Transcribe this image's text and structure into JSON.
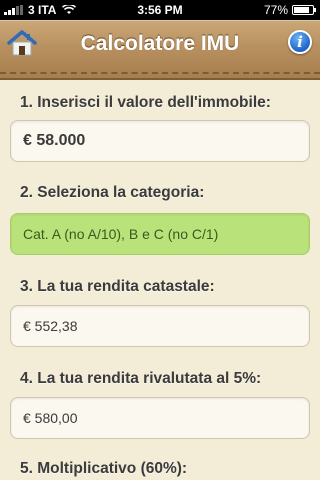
{
  "status": {
    "carrier": "3 ITA",
    "time": "3:56 PM",
    "battery": "77%"
  },
  "nav": {
    "title": "Calcolatore IMU",
    "home_icon": "home-icon",
    "info_icon": "info-icon",
    "info_glyph": "i"
  },
  "form": {
    "step1_label": "1. Inserisci il valore dell'immobile:",
    "step1_value": "€ 58.000",
    "step2_label": "2. Seleziona la categoria:",
    "step2_value": "Cat. A (no A/10), B e C (no C/1)",
    "step3_label": "3. La tua rendita catastale:",
    "step3_value": "€ 552,38",
    "step4_label": "4. La tua rendita rivalutata  al 5%:",
    "step4_value": "€ 580,00",
    "step5_label": "5. Moltiplicativo (60%):"
  },
  "colors": {
    "background": "#f3ecd6",
    "nav": "#b99161",
    "selected": "#b9e37a",
    "info": "#1d64c9"
  }
}
